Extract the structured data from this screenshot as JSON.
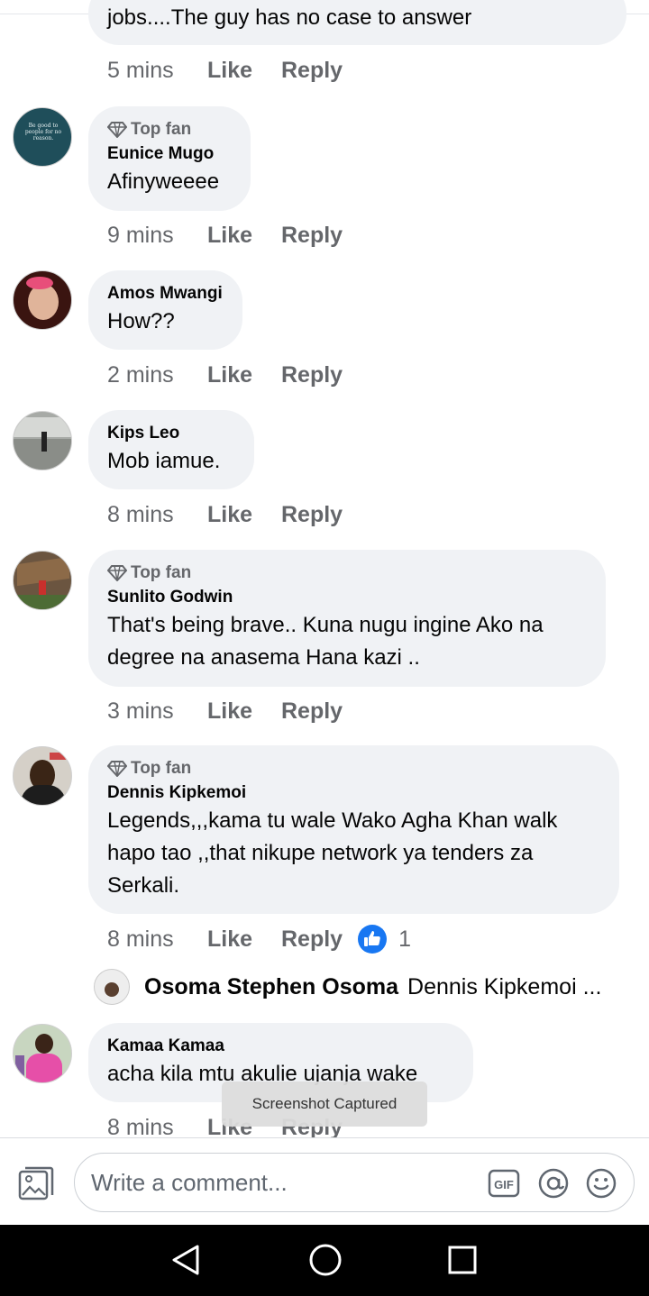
{
  "comments": [
    {
      "id": "c0",
      "partial_text": "jobs....The guy has no case to answer",
      "time": "5 mins",
      "like": "Like",
      "reply": "Reply"
    },
    {
      "id": "c1",
      "top_fan": "Top fan",
      "name": "Eunice Mugo",
      "lines": [
        "Afinyweeee"
      ],
      "time": "9 mins",
      "like": "Like",
      "reply": "Reply",
      "avatar_text": "Be good to people for no reason."
    },
    {
      "id": "c2",
      "name": "Amos Mwangi",
      "lines": [
        "How??"
      ],
      "time": "2 mins",
      "like": "Like",
      "reply": "Reply"
    },
    {
      "id": "c3",
      "name": "Kips Leo",
      "lines": [
        "Mob iamue."
      ],
      "time": "8 mins",
      "like": "Like",
      "reply": "Reply"
    },
    {
      "id": "c4",
      "top_fan": "Top fan",
      "name": "Sunlito Godwin",
      "lines": [
        "That's being brave.. Kuna nugu ingine Ako na",
        "degree na anasema Hana kazi .."
      ],
      "time": "3 mins",
      "like": "Like",
      "reply": "Reply"
    },
    {
      "id": "c5",
      "top_fan": "Top fan",
      "name": "Dennis Kipkemoi",
      "lines": [
        "Legends,,,kama tu wale Wako Agha Khan walk",
        "hapo tao ,,that nikupe network ya tenders za",
        "Serkali."
      ],
      "time": "8 mins",
      "like": "Like",
      "reply": "Reply",
      "reaction_count": "1"
    },
    {
      "id": "c6",
      "name": "Kamaa Kamaa",
      "lines": [
        "acha kila mtu akulie ujanja wake"
      ],
      "time": "8 mins",
      "like": "Like",
      "reply": "Reply"
    }
  ],
  "nested_reply": {
    "name": "Osoma Stephen Osoma",
    "preview": "Dennis Kipkemoi ..."
  },
  "toast": "Screenshot Captured",
  "composer": {
    "placeholder": "Write a comment...",
    "gif_label": "GIF"
  },
  "colors": {
    "bubble": "#f0f2f5",
    "meta": "#65676b",
    "like_blue": "#1877f2",
    "navbar": "#000000"
  },
  "icons": [
    "diamond-icon",
    "photo-icon",
    "gif-icon",
    "at-icon",
    "smiley-icon",
    "thumbs-up-icon",
    "back-icon",
    "home-icon",
    "recents-icon"
  ]
}
